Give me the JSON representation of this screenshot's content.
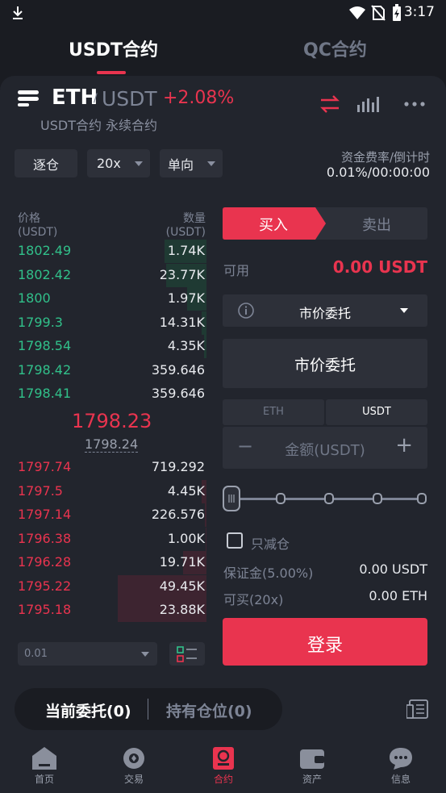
{
  "status_bar": {
    "time": "3:17"
  },
  "tabs": [
    {
      "label": "USDT合约",
      "active": true
    },
    {
      "label": "QC合约",
      "active": false
    }
  ],
  "header": {
    "base": "ETH",
    "separator": "/",
    "quote": "USDT",
    "change": "+2.08%",
    "subtitle": "USDT合约 永续合约"
  },
  "controls": {
    "margin_mode": "逐仓",
    "leverage": "20x",
    "position_mode": "单向",
    "funding_label": "资金费率/倒计时",
    "funding_value": "0.01%/00:00:00"
  },
  "orderbook": {
    "price_header": "价格",
    "price_unit": "(USDT)",
    "qty_header": "数量",
    "qty_unit": "(USDT)",
    "asks": [
      {
        "price": "1802.49",
        "qty": "1.74K",
        "depth": 0.47
      },
      {
        "price": "1802.42",
        "qty": "23.77K",
        "depth": 0.45
      },
      {
        "price": "1800",
        "qty": "1.97K",
        "depth": 0.22
      },
      {
        "price": "1799.3",
        "qty": "14.31K",
        "depth": 0.05
      },
      {
        "price": "1798.54",
        "qty": "4.35K",
        "depth": 0.03
      },
      {
        "price": "1798.42",
        "qty": "359.646",
        "depth": 0.0
      },
      {
        "price": "1798.41",
        "qty": "359.646",
        "depth": 0.0
      }
    ],
    "last_price": "1798.23",
    "mark_price": "1798.24",
    "bids": [
      {
        "price": "1797.74",
        "qty": "719.292",
        "depth": 0.0
      },
      {
        "price": "1797.5",
        "qty": "4.45K",
        "depth": 0.05
      },
      {
        "price": "1797.14",
        "qty": "226.576",
        "depth": 0.02
      },
      {
        "price": "1796.38",
        "qty": "1.00K",
        "depth": 0.01
      },
      {
        "price": "1796.28",
        "qty": "19.71K",
        "depth": 0.26
      },
      {
        "price": "1795.22",
        "qty": "49.45K",
        "depth": 1.0
      },
      {
        "price": "1795.18",
        "qty": "23.88K",
        "depth": 1.0
      }
    ],
    "precision": "0.01"
  },
  "trade": {
    "buy_label": "买入",
    "sell_label": "卖出",
    "available_label": "可用",
    "available_value": "0.00 USDT",
    "order_type": "市价委托",
    "price_display": "市价委托",
    "unit_eth": "ETH",
    "unit_usdt": "USDT",
    "amount_placeholder": "金额(USDT)",
    "minus": "−",
    "plus": "+",
    "reduce_only": "只减仓",
    "margin_label": "保证金(5.00%)",
    "margin_value": "0.00 USDT",
    "max_buy_label": "可买(20x)",
    "max_buy_value": "0.00 ETH",
    "login_button": "登录"
  },
  "orders_tabs": {
    "current": "当前委托(0)",
    "positions": "持有仓位(0)"
  },
  "bottom_nav": [
    {
      "label": "首页",
      "icon": "home-icon",
      "active": false
    },
    {
      "label": "交易",
      "icon": "trade-icon",
      "active": false
    },
    {
      "label": "合约",
      "icon": "contract-icon",
      "active": true
    },
    {
      "label": "资产",
      "icon": "wallet-icon",
      "active": false
    },
    {
      "label": "信息",
      "icon": "message-icon",
      "active": false
    }
  ],
  "colors": {
    "accent": "#e9344f",
    "bid": "#31c08a",
    "ask": "#e9344f",
    "background": "#1a1c22",
    "panel": "#22252d"
  }
}
